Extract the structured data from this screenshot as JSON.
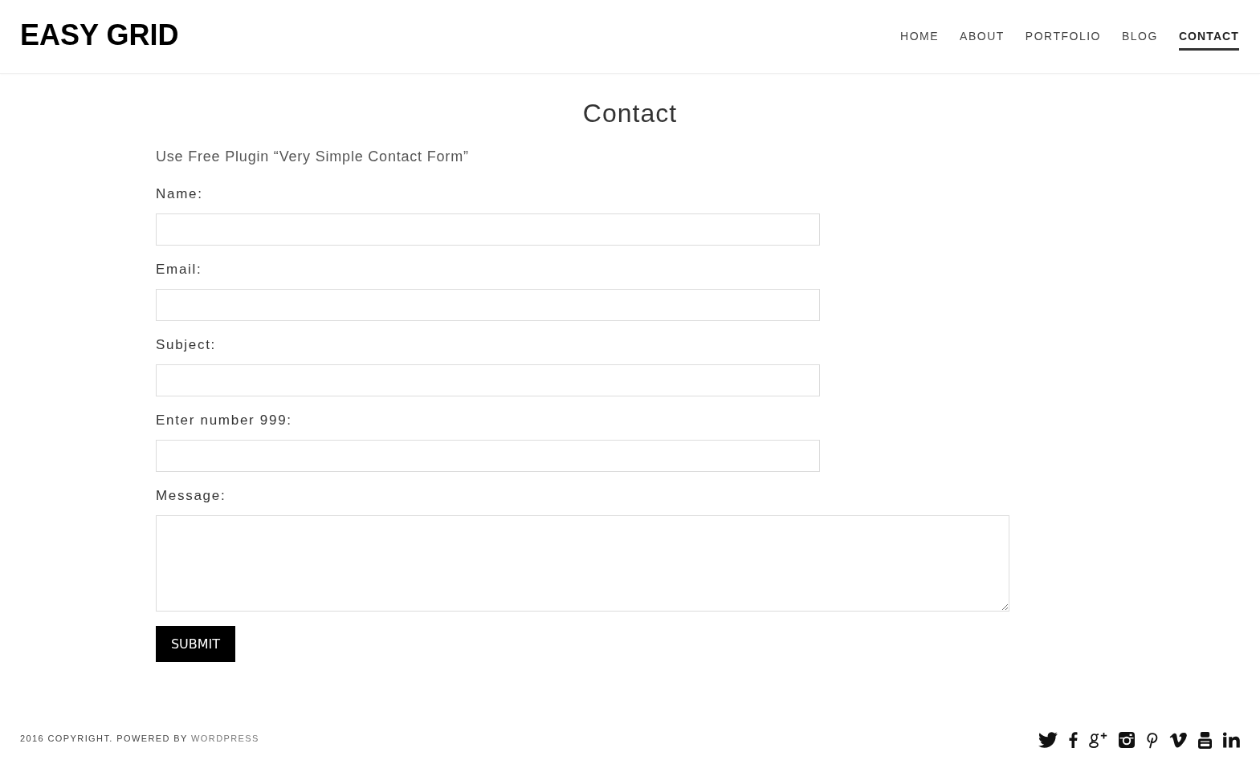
{
  "site": {
    "logo": "EASY GRID"
  },
  "nav": [
    {
      "label": "HOME",
      "selected": false
    },
    {
      "label": "ABOUT",
      "selected": false
    },
    {
      "label": "PORTFOLIO",
      "selected": false
    },
    {
      "label": "BLOG",
      "selected": false
    },
    {
      "label": "CONTACT",
      "selected": true
    }
  ],
  "page": {
    "title": "Contact",
    "intro": "Use Free Plugin “Very Simple Contact Form”"
  },
  "form": {
    "fields": [
      {
        "label": "Name:",
        "kind": "input"
      },
      {
        "label": "Email:",
        "kind": "input"
      },
      {
        "label": "Subject:",
        "kind": "input"
      },
      {
        "label": "Enter number 999:",
        "kind": "input"
      },
      {
        "label": "Message:",
        "kind": "textarea"
      }
    ],
    "submit": "SUBMIT"
  },
  "footer": {
    "text": "2016 COPYRIGHT. POWERED BY",
    "link": "WORDPRESS"
  }
}
